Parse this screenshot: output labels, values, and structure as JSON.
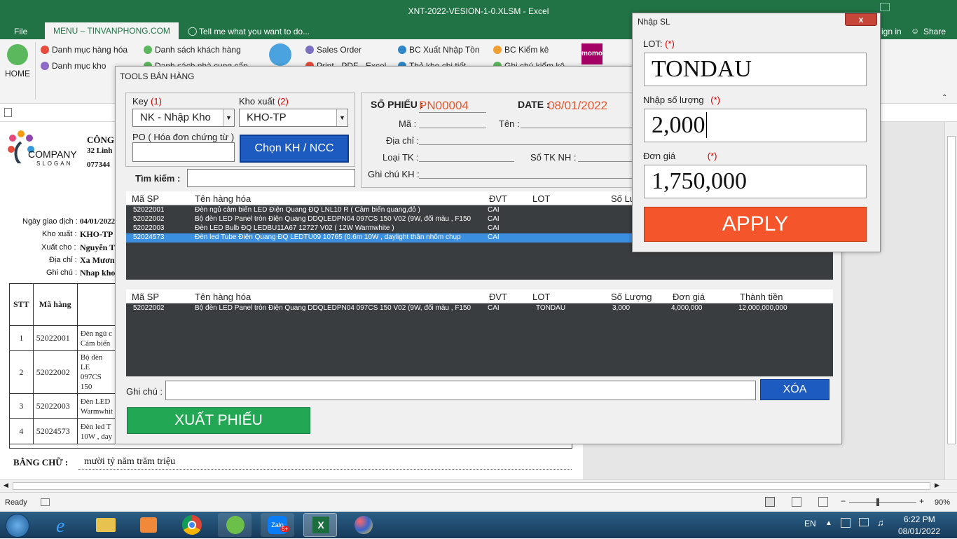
{
  "excel": {
    "title": "XNT-2022-VESION-1-0.XLSM - Excel",
    "menu": {
      "file": "File",
      "tab_active": "MENU – TINVANPHONG.COM",
      "tell": "Tell me what you want to do...",
      "sign_in": "ign in",
      "share": "Share"
    },
    "ribbon": {
      "home": "HOME",
      "dm_hang_hoa": "Danh mục hàng hóa",
      "dm_kho": "Danh mục kho",
      "ds_khach_hang": "Danh sách khách hàng",
      "ds_ncc": "Danh sách nhà cung cấp",
      "sales_order": "Sales Order",
      "print": "Print - PDF - Excel",
      "bc_xnt": "BC Xuất Nhập Tồn",
      "the_kho": "Thẻ kho chi tiết",
      "bc_kiem_ke": "BC Kiểm kê",
      "ghi_chu_kk": "Ghi chú kiểm kê",
      "momo": "momo"
    },
    "status": {
      "ready": "Ready",
      "zoom": "90%"
    }
  },
  "worksheet": {
    "company": "COMPANY",
    "slogan": "SLOGAN",
    "cong": "CÔNG",
    "addr": "32 Linh",
    "phone": "077344",
    "fields": [
      {
        "label": "Ngày giao dịch :",
        "value": "04/01/2022"
      },
      {
        "label": "Kho xuất :",
        "value": "KHO-TP"
      },
      {
        "label": "Xuất cho :",
        "value": "Nguyễn T"
      },
      {
        "label": "Địa chỉ :",
        "value": "Xa Mương"
      },
      {
        "label": "Ghi chú :",
        "value": "Nhap kho"
      }
    ],
    "table_headers": {
      "stt": "STT",
      "ma": "Mã hàng"
    },
    "rows": [
      {
        "stt": "1",
        "ma": "52022001",
        "ten1": "Đèn ngủ c",
        "ten2": "Cảm biến"
      },
      {
        "stt": "2",
        "ma": "52022002",
        "ten1": "Bộ đèn LE",
        "ten2": "097CS 150"
      },
      {
        "stt": "3",
        "ma": "52022003",
        "ten1": "Đèn LED",
        "ten2": "Warmwhit"
      },
      {
        "stt": "4",
        "ma": "52024573",
        "ten1": "Đèn led T",
        "ten2": "10W , day"
      }
    ],
    "bang_chu_label": "BẰNG CHỮ :",
    "bang_chu_value": "mười tỷ năm trăm triệu"
  },
  "tools": {
    "title": "TOOLS BÁN HÀNG",
    "key_label": "Key",
    "key_num": "(1)",
    "key_value": "NK - Nhập Kho",
    "kho_label": "Kho xuất",
    "kho_num": "(2)",
    "kho_value": "KHO-TP",
    "po_label": "PO ( Hóa đơn chứng từ )",
    "po_value": "",
    "chon_button": "Chọn KH / NCC",
    "tim_kiem": "Tìm kiếm :",
    "so_phieu_label": "SỐ PHIẾU :",
    "so_phieu_value": "PN00004",
    "date_label": "DATE :",
    "date_value": "08/01/2022",
    "ma_label": "Mã :",
    "ten_label": "Tên :",
    "dia_chi_label": "Địa chỉ :",
    "loai_tk_label": "Loại TK :",
    "so_tk_label": "Số TK NH :",
    "ghi_chu_kh_label": "Ghi chú KH :",
    "grid1_headers": [
      "Mã SP",
      "Tên hàng hóa",
      "ĐVT",
      "LOT",
      "Số Lư"
    ],
    "grid1_rows": [
      {
        "ma": "52022001",
        "ten": "Đèn ngủ cảm biến LED Điện Quang ĐQ LNL10 R  ( Cảm biến quang,đỏ )",
        "dvt": "CAI"
      },
      {
        "ma": "52022002",
        "ten": "Bộ đèn LED Panel tròn Điện Quang DDQLEDPN04 097CS 150 V02 (9W, đổi màu , F150",
        "dvt": "CAI"
      },
      {
        "ma": "52022003",
        "ten": "Đèn LED Bulb ĐQ LEDBU11A67 12727 V02 ( 12W Warmwhite )",
        "dvt": "CAI"
      },
      {
        "ma": "52024573",
        "ten": "Đèn led Tube Điện Quang ĐQ LEDTU09 10765 (0.6m 10W , daylight thân nhôm chụp",
        "dvt": "CAI"
      }
    ],
    "grid2_headers": [
      "Mã SP",
      "Tên hàng hóa",
      "ĐVT",
      "LOT",
      "Số Lượng",
      "Đơn giá",
      "Thành tiền"
    ],
    "grid2_rows": [
      {
        "ma": "52022002",
        "ten": "Bộ đèn LED Panel tròn Điện Quang DDQLEDPN04 097CS 150 V02 (9W, đổi màu , F150",
        "dvt": "CAI",
        "lot": "TONDAU",
        "sl": "3,000",
        "dg": "4,000,000",
        "tt": "12,000,000,000"
      }
    ],
    "ghi_chu_label": "Ghi chú :",
    "xoa_button": "XÓA",
    "xuat_button": "XUẤT PHIẾU"
  },
  "nhap_sl": {
    "title": "Nhập SL",
    "close": "x",
    "lot_label": "LOT:",
    "lot_req": "(*)",
    "lot_value": "TONDAU",
    "sl_label": "Nhập số lượng",
    "sl_req": "(*)",
    "sl_value": "2,000",
    "dg_label": "Đơn giá",
    "dg_req": "(*)",
    "dg_value": "1,750,000",
    "apply": "APPLY"
  },
  "taskbar": {
    "lang": "EN",
    "time": "6:22 PM",
    "date": "08/01/2022",
    "zalo_badge": "5+"
  }
}
